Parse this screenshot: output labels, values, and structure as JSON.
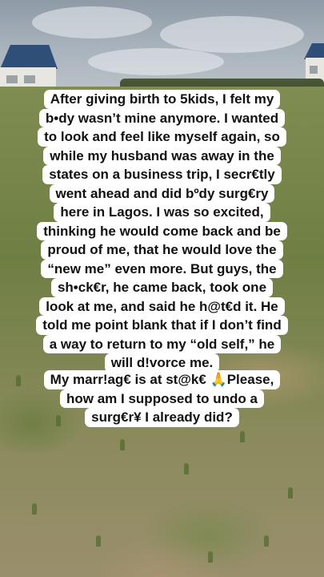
{
  "story": {
    "paragraph_1_lines": [
      "After giving birth to 5kids, I felt my",
      "b•dy wasn’t mine anymore. I wanted",
      "to look and feel like myself again, so",
      "while my husband was away in the",
      "states on a business trip, I secr€tly",
      "went ahead and did bºdy surg€ry",
      "here in Lagos. I was so excited,",
      "thinking he would come back and be",
      "proud of me, that he would love the",
      "“new me” even more. But guys, the",
      "sh•ck€r, he came back, took one",
      "look at me, and said he h@t€d it. He",
      "told me point blank that if I don’t find",
      "a way to return to my “old self,” he",
      "will d!vorce me."
    ],
    "paragraph_2_lines": [
      "My marr!ag€ is at st@k€ 🙏Please,",
      "how am I supposed to undo a",
      "surg€r¥ I already did?"
    ]
  },
  "icons": {
    "praying_hands": "praying-hands-icon"
  },
  "colors": {
    "caption_background": "#ffffff",
    "caption_text": "#111111",
    "roof": "#2f4f78"
  }
}
